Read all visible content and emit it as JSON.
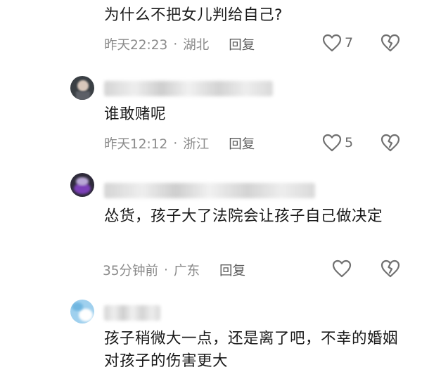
{
  "comments": [
    {
      "text": "为什么不把女儿判给自己?",
      "time": "昨天22:23",
      "location": "湖北",
      "reply": "回复",
      "likes": "7"
    },
    {
      "text": "谁敢赌呢",
      "time": "昨天12:12",
      "location": "浙江",
      "reply": "回复",
      "likes": "5"
    },
    {
      "text": "怂货，孩子大了法院会让孩子自己做决定",
      "time": "35分钟前",
      "location": "广东",
      "reply": "回复",
      "likes": ""
    },
    {
      "text": "孩子稍微大一点，还是离了吧，不幸的婚姻对孩子的伤害更大"
    }
  ],
  "separator": "·",
  "icons": {
    "like": "heart-outline-icon",
    "dislike": "broken-heart-icon"
  },
  "colors": {
    "meta_gray": "#8a8a8a",
    "icon_gray": "#707070"
  }
}
